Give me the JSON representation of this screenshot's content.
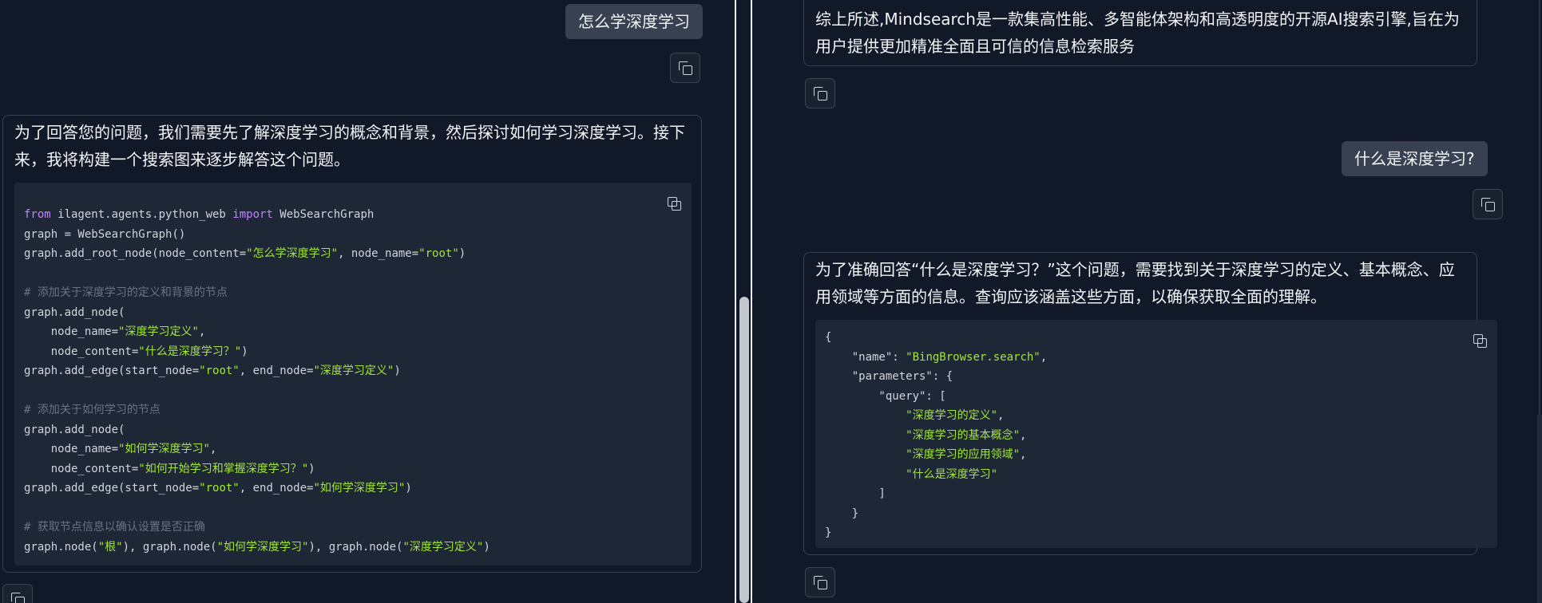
{
  "left": {
    "user_message": "怎么学深度学习",
    "assistant_text": "为了回答您的问题，我们需要先了解深度学习的概念和背景，然后探讨如何学习深度学习。接下来，我将构建一个搜索图来逐步解答这个问题。",
    "code": {
      "l1_kw1": "from",
      "l1_mod": " ilagent.agents.python_web ",
      "l1_kw2": "import",
      "l1_rest": " WebSearchGraph",
      "l2": "graph = WebSearchGraph()",
      "l3_a": "graph.add_root_node(node_content=",
      "l3_s1": "\"怎么学深度学习\"",
      "l3_b": ", node_name=",
      "l3_s2": "\"root\"",
      "l3_c": ")",
      "c1": "# 添加关于深度学习的定义和背景的节点",
      "l5": "graph.add_node(",
      "l6_a": "    node_name=",
      "l6_s": "\"深度学习定义\"",
      "l6_b": ",",
      "l7_a": "    node_content=",
      "l7_s": "\"什么是深度学习？\"",
      "l7_b": ")",
      "l8_a": "graph.add_edge(start_node=",
      "l8_s1": "\"root\"",
      "l8_b": ", end_node=",
      "l8_s2": "\"深度学习定义\"",
      "l8_c": ")",
      "c2": "# 添加关于如何学习的节点",
      "l10": "graph.add_node(",
      "l11_a": "    node_name=",
      "l11_s": "\"如何学深度学习\"",
      "l11_b": ",",
      "l12_a": "    node_content=",
      "l12_s": "\"如何开始学习和掌握深度学习？\"",
      "l12_b": ")",
      "l13_a": "graph.add_edge(start_node=",
      "l13_s1": "\"root\"",
      "l13_b": ", end_node=",
      "l13_s2": "\"如何学深度学习\"",
      "l13_c": ")",
      "c3": "# 获取节点信息以确认设置是否正确",
      "l15_a": "graph.node(",
      "l15_s1": "\"根\"",
      "l15_b": "), graph.node(",
      "l15_s2": "\"如何学深度学习\"",
      "l15_c": "), graph.node(",
      "l15_s3": "\"深度学习定义\"",
      "l15_d": ")"
    }
  },
  "right": {
    "summary_text": "综上所述,Mindsearch是一款集高性能、多智能体架构和高透明度的开源AI搜索引擎,旨在为用户提供更加精准全面且可信的信息检索服务",
    "user_message": "什么是深度学习?",
    "assistant_text": "为了准确回答“什么是深度学习？”这个问题，需要找到关于深度学习的定义、基本概念、应用领域等方面的信息。查询应该涵盖这些方面，以确保获取全面的理解。",
    "json": {
      "l1": "{",
      "l2_a": "    \"name\": ",
      "l2_s": "\"BingBrowser.search\"",
      "l2_b": ",",
      "l3": "    \"parameters\": {",
      "l4": "        \"query\": [",
      "l5_s": "            \"深度学习的定义\"",
      "l5_b": ",",
      "l6_s": "            \"深度学习的基本概念\"",
      "l6_b": ",",
      "l7_s": "            \"深度学习的应用领域\"",
      "l7_b": ",",
      "l8_s": "            \"什么是深度学习\"",
      "l9": "        ]",
      "l10": "    }",
      "l11": "}"
    }
  },
  "icons": {
    "copy": "copy-icon"
  }
}
